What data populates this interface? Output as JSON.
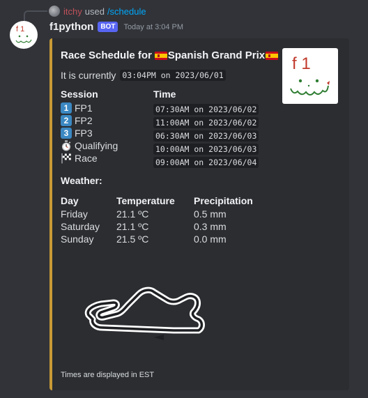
{
  "reply": {
    "username": "itchy",
    "used_text": "used",
    "command": "/schedule"
  },
  "message": {
    "username": "f1python",
    "badge": "BOT",
    "timestamp": "Today at 3:04 PM"
  },
  "embed": {
    "accent_color": "#c89a36",
    "title_prefix": "Race Schedule for",
    "grand_prix": "Spanish Grand Prix",
    "current_prefix": "It is currently",
    "current_time": "03:04PM on 2023/06/01",
    "session_header": "Session",
    "time_header": "Time",
    "sessions": [
      {
        "badge": "1",
        "icon": "keycap-1-icon",
        "name": "FP1",
        "time": "07:30AM on 2023/06/02"
      },
      {
        "badge": "2",
        "icon": "keycap-2-icon",
        "name": "FP2",
        "time": "11:00AM on 2023/06/02"
      },
      {
        "badge": "3",
        "icon": "keycap-3-icon",
        "name": "FP3",
        "time": "06:30AM on 2023/06/03"
      },
      {
        "badge": "",
        "icon": "stopwatch-icon",
        "name": "Qualifying",
        "time": "10:00AM on 2023/06/03"
      },
      {
        "badge": "",
        "icon": "checkered-flag-icon",
        "name": "Race",
        "time": "09:00AM on 2023/06/04"
      }
    ],
    "weather_label": "Weather:",
    "weather_headers": [
      "Day",
      "Temperature",
      "Precipitation"
    ],
    "weather": [
      {
        "day": "Friday",
        "temp": "21.1 ºC",
        "precip": "0.5 mm"
      },
      {
        "day": "Saturday",
        "temp": "21.1 ºC",
        "precip": "0.3 mm"
      },
      {
        "day": "Sunday",
        "temp": "21.5 ºC",
        "precip": "0.0 mm"
      }
    ],
    "footer": "Times are displayed in EST"
  },
  "icons": {
    "flag": "spain-flag-icon",
    "thumbnail": "f1-smiley-doodle",
    "track": "circuit-de-barcelona-catalunya-map"
  }
}
